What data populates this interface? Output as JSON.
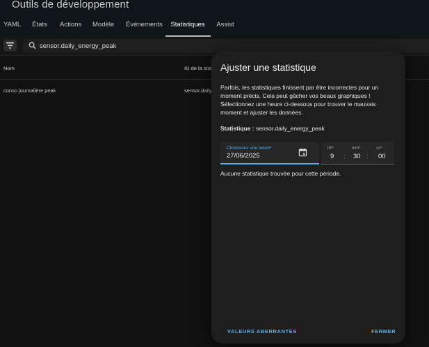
{
  "header": {
    "title": "Outils de développement",
    "tabs": [
      {
        "label": "YAML"
      },
      {
        "label": "États"
      },
      {
        "label": "Actions"
      },
      {
        "label": "Modèle"
      },
      {
        "label": "Événements"
      },
      {
        "label": "Statistiques"
      },
      {
        "label": "Assist"
      }
    ],
    "active_tab": "Statistiques"
  },
  "filter": {
    "search_value": "sensor.daily_energy_peak",
    "icons": {
      "filter": "filter-list-icon",
      "search": "search-icon"
    }
  },
  "table": {
    "columns": [
      "Nom",
      "ID de la stat"
    ],
    "rows": [
      {
        "name": "conso journalière peak",
        "stat_id": "sensor.daily"
      }
    ]
  },
  "dialog": {
    "title": "Ajuster une statistique",
    "description": "Parfois, les statistiques finissent par être incorrectes pour un moment précis. Cela peut gâcher vos beaux graphiques ! Sélectionnez une heure ci-dessous pour trouver le mauvais moment et ajuster les données.",
    "statistic_label": "Statistique :",
    "statistic_value": "sensor.daily_energy_peak",
    "date": {
      "label": "Choisissez une heure*",
      "value": "27/06/2025",
      "icon": "calendar-icon"
    },
    "time": {
      "hh_label": "hh*",
      "hh_value": "9",
      "mm_label": "mm*",
      "mm_value": "30",
      "ss_label": "ss*",
      "ss_value": "00",
      "separator": ":"
    },
    "empty_message": "Aucune statistique trouvée pour cette période.",
    "buttons": {
      "outliers": "VALEURS ABERRANTES",
      "close": "FERMER"
    }
  },
  "colors": {
    "accent": "#4fb2ee",
    "background": "#111111",
    "header_bg": "#0f1619",
    "dialog_bg": "#1e1e1e"
  }
}
